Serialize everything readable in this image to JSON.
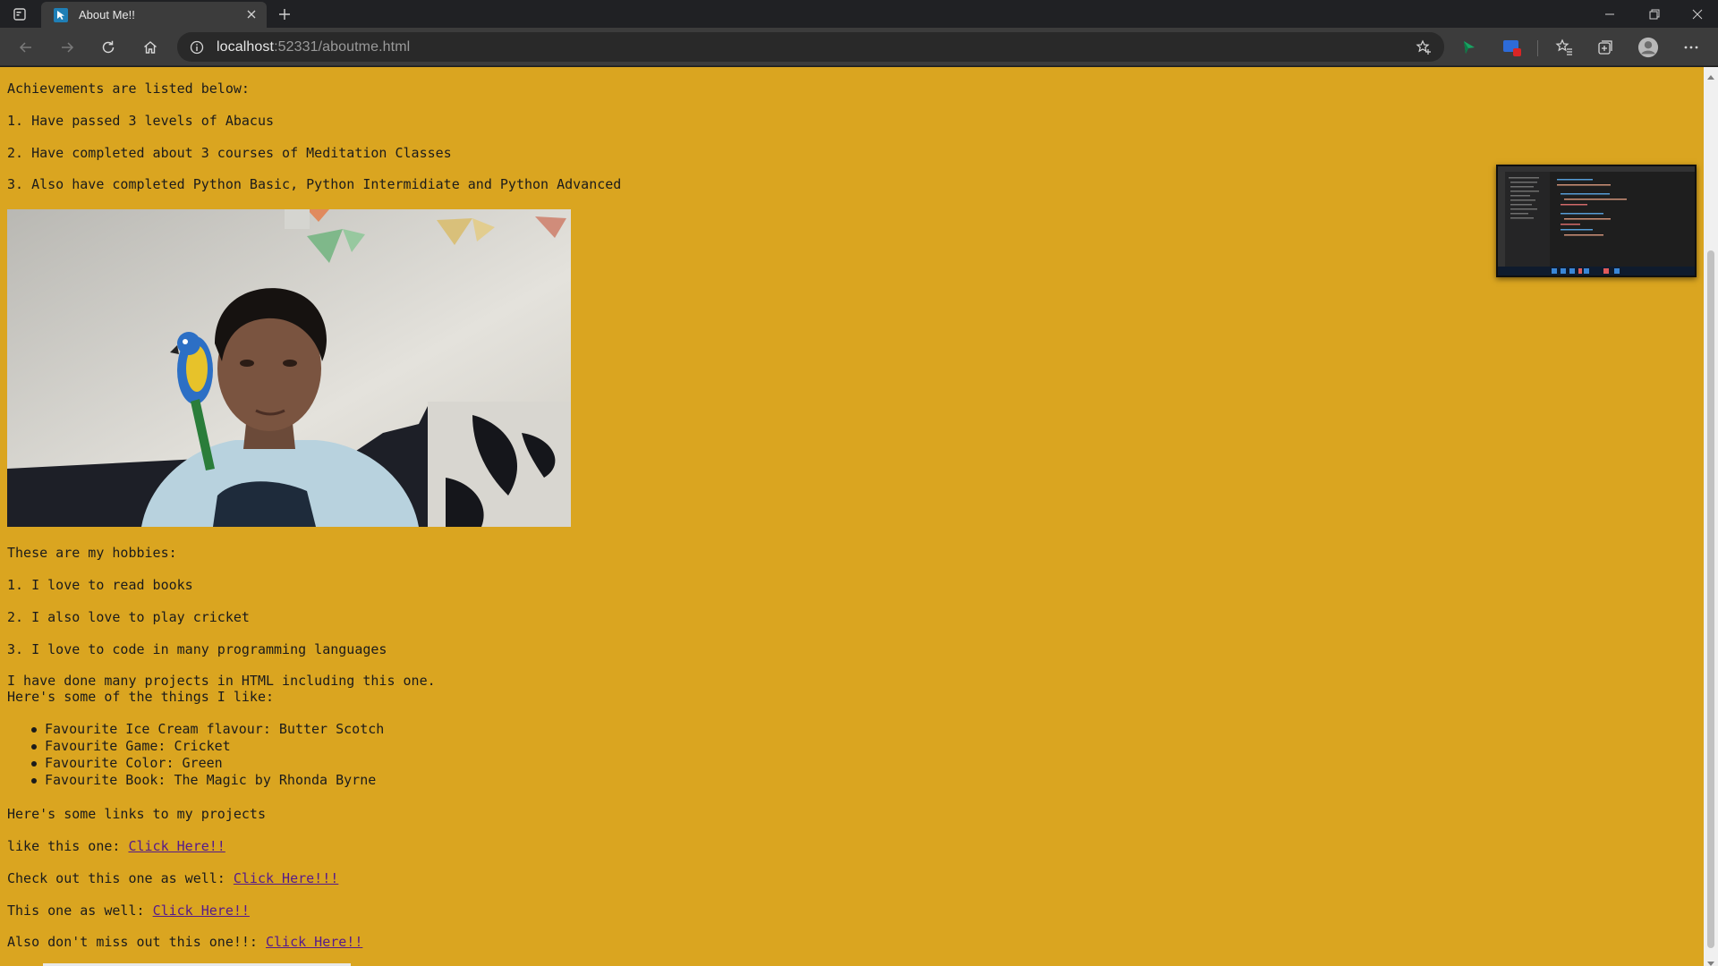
{
  "browser": {
    "tab_title": "About Me!!",
    "url_host": "localhost",
    "url_rest": ":52331/aboutme.html",
    "accent": "#daa520"
  },
  "page": {
    "achievements_heading": "Achievements are listed below:",
    "achievements": [
      "1. Have passed 3 levels of Abacus",
      "2. Have completed about 3 courses of Meditation Classes",
      "3. Also have completed Python Basic, Python Intermidiate and Python Advanced"
    ],
    "hobbies_heading": "These are my hobbies:",
    "hobbies": [
      "1. I love to read books",
      "2. I also love to play cricket",
      "3. I love to code in many programming languages"
    ],
    "projects_line": "I have done many projects in HTML including this one.",
    "likes_heading": "Here's some of the things I like:",
    "likes": [
      "Favourite Ice Cream flavour: Butter Scotch",
      "Favourite Game: Cricket",
      "Favourite Color: Green",
      "Favourite Book: The Magic by Rhonda Byrne"
    ],
    "links_heading": "Here's some links to my projects",
    "links": [
      {
        "prefix": "like this one: ",
        "label": "Click Here!!"
      },
      {
        "prefix": "Check out this one as well: ",
        "label": "Click Here!!!"
      },
      {
        "prefix": "This one as well: ",
        "label": "Click Here!!"
      },
      {
        "prefix": "Also don't miss out this one!!: ",
        "label": "Click Here!!"
      }
    ]
  }
}
